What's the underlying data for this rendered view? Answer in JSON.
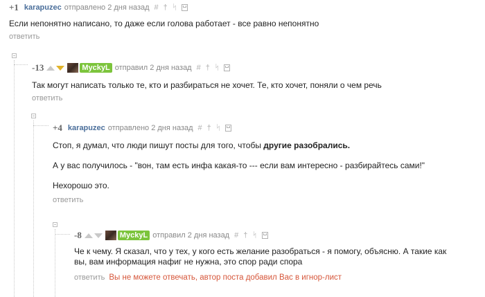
{
  "tools": {
    "hash": "#",
    "up": "†",
    "branch": "ᛋ"
  },
  "reply_label": "ответить",
  "colors": {
    "author": "#4a6e9a",
    "badge": "#7cc43c",
    "blocked": "#d6563a",
    "vote_down_active": "#e2b32a"
  },
  "comments": [
    {
      "rating": "+1",
      "author": "karapuzec",
      "date": "отправлено 2 дня назад",
      "text": "Если непонятно написано, то даже если голова работает - все равно непонятно"
    },
    {
      "rating": "-13",
      "author": "MyckyL",
      "date": "отправил 2 дня назад",
      "text": "Так могут написать только те, кто и разбираться не хочет. Те, кто хочет, поняли о чем речь"
    },
    {
      "rating": "+4",
      "author": "karapuzec",
      "date": "отправлено 2 дня назад",
      "p1_start": "Стоп, я думал, что люди пишут посты для того, чтобы ",
      "p1_bold": "другие разобрались.",
      "p2": "А у вас получилось - \"вон, там есть инфа какая-то --- если вам интересно - разбирайтесь сами!\"",
      "p3": "Нехорошо это."
    },
    {
      "rating": "-8",
      "author": "MyckyL",
      "date": "отправил 2 дня назад",
      "text_line1": "Че к чему. Я сказал, что у тех, у кого есть желание разобраться - я помогу, объясню. А такие как",
      "text_line2": "вы, вам информация нафиг не нужна, это спор ради спора",
      "blocked_note": "Вы не можете отвечать, автор поста добавил Вас в игнор-лист"
    }
  ]
}
